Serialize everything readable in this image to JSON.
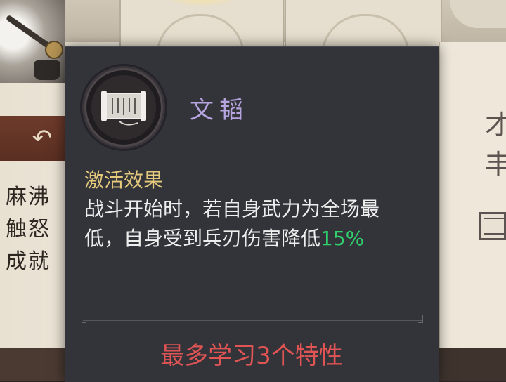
{
  "background": {
    "left_text_lines": [
      "麻沸",
      "触怒",
      "成就"
    ],
    "right_glyphs": [
      "才",
      "丰"
    ],
    "back_icon": "undo-arrow-icon"
  },
  "tooltip": {
    "icon": "scroll-icon",
    "skill_name": "文韬",
    "section_title": "激活效果",
    "effect_main": "战斗开始时，若自身武力为全场最低，自身受到兵刃伤害降低",
    "effect_value": "15%",
    "learn_limit": "最多学习3个特性"
  },
  "colors": {
    "skill_name": "#b6a4df",
    "section_title": "#e5ca7e",
    "effect_value": "#2fcf6c",
    "learn_limit": "#e05454",
    "tooltip_bg": "#33343a"
  }
}
